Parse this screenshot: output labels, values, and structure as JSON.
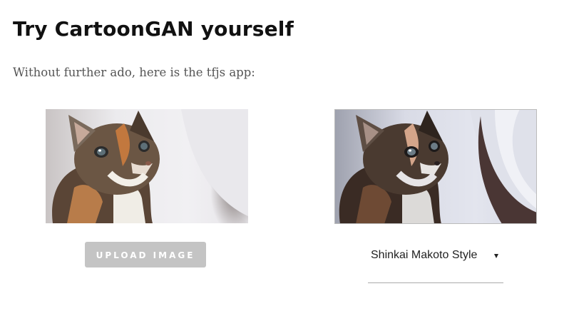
{
  "section": {
    "heading": "Try CartoonGAN yourself",
    "intro": "Without further ado, here is the tfjs app:"
  },
  "images": {
    "original": {
      "icon": "kitten-photo",
      "kind": "photo"
    },
    "cartoon": {
      "icon": "kitten-cartoonized",
      "kind": "photo"
    }
  },
  "controls": {
    "upload_label": "UPLOAD IMAGE",
    "upload_color": "#c4c4c4",
    "style_selected": "Shinkai Makoto Style",
    "caret_icon": "triangle-down-icon"
  }
}
